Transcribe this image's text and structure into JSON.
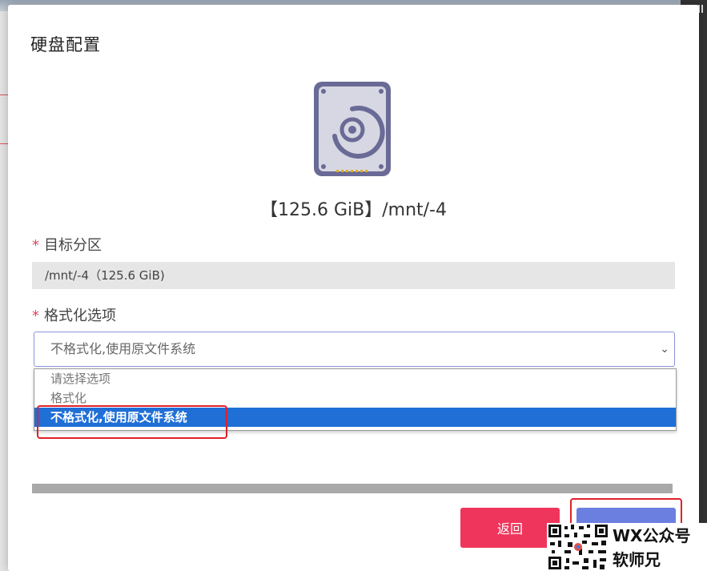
{
  "dialog": {
    "title": "硬盘配置",
    "disk_caption": "【125.6 GiB】/mnt/-4"
  },
  "fields": {
    "target_partition": {
      "label": "目标分区",
      "required_mark": "*",
      "value": "/mnt/-4（125.6 GiB)"
    },
    "format_option": {
      "label": "格式化选项",
      "required_mark": "*",
      "selected_value": "不格式化,使用原文件系统",
      "options": [
        "请选择选项",
        "格式化",
        "不格式化,使用原文件系统"
      ],
      "highlighted_index": 2
    }
  },
  "progress_fraction": 1.0,
  "buttons": {
    "back_label": "返回",
    "confirm_label": ""
  },
  "watermark": {
    "line1": "WX公众号",
    "line2": "软师兄"
  },
  "colors": {
    "accent_blue": "#1f6fd6",
    "back_button": "#f0355c",
    "confirm_button": "#6a7fe0",
    "required": "#e0455a",
    "annotation_red": "#e0202a"
  },
  "icons": {
    "disk": "hard-disk-icon",
    "chevron": "chevron-down-icon",
    "qr": "qr-code-icon"
  }
}
